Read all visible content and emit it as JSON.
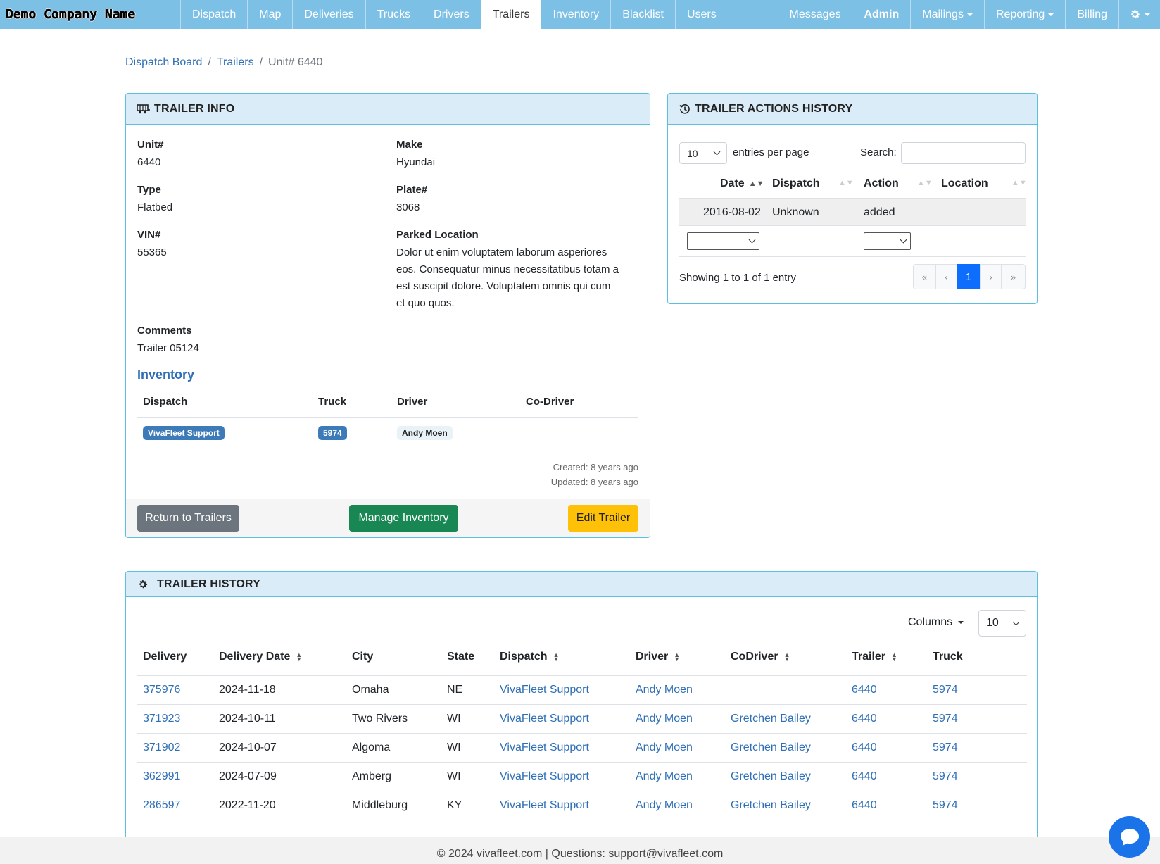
{
  "nav": {
    "brand": "Demo Company Name",
    "items": [
      "Dispatch",
      "Map",
      "Deliveries",
      "Trucks",
      "Drivers",
      "Trailers",
      "Inventory",
      "Blacklist",
      "Users"
    ],
    "right": [
      "Messages",
      "Admin",
      "Mailings",
      "Reporting",
      "Billing"
    ],
    "active": "Trailers"
  },
  "breadcrumb": {
    "home": "Dispatch Board",
    "section": "Trailers",
    "current": "Unit# 6440"
  },
  "trailer_info": {
    "title": "TRAILER INFO",
    "unit_label": "Unit#",
    "unit": "6440",
    "make_label": "Make",
    "make": "Hyundai",
    "type_label": "Type",
    "type": "Flatbed",
    "plate_label": "Plate#",
    "plate": "3068",
    "vin_label": "VIN#",
    "vin": "55365",
    "parked_label": "Parked Location",
    "parked_lines": [
      "Dolor ut enim voluptatem laborum asperiores",
      "eos. Consequatur minus necessitatibus totam a",
      "est suscipit dolore. Voluptatem omnis qui cum",
      "et quo quos."
    ],
    "comments_label": "Comments",
    "comments": "Trailer 05124",
    "inventory_title": "Inventory",
    "inventory_headers": [
      "Dispatch",
      "Truck",
      "Driver",
      "Co-Driver"
    ],
    "inventory_row": {
      "dispatch": "VivaFleet Support",
      "truck": "5974",
      "driver": "Andy Moen",
      "codriver": ""
    },
    "created": "Created: 8 years ago",
    "updated": "Updated: 8 years ago",
    "btn_return": "Return to Trailers",
    "btn_manage": "Manage Inventory",
    "btn_edit": "Edit Trailer"
  },
  "actions_history": {
    "title": "TRAILER ACTIONS HISTORY",
    "entries_value": "10",
    "entries_label": "entries per page",
    "search_label": "Search:",
    "search_value": "",
    "headers": [
      "Date",
      "Dispatch",
      "Action",
      "Location"
    ],
    "rows": [
      {
        "date": "2016-08-02",
        "dispatch": "Unknown",
        "action": "added",
        "location": ""
      }
    ],
    "info": "Showing 1 to 1 of 1 entry",
    "pages": [
      "«",
      "‹",
      "1",
      "›",
      "»"
    ]
  },
  "trailer_history": {
    "title": "TRAILER HISTORY",
    "columns_label": "Columns",
    "page_size": "10",
    "headers": [
      "Delivery",
      "Delivery Date",
      "City",
      "State",
      "Dispatch",
      "Driver",
      "CoDriver",
      "Trailer",
      "Truck"
    ],
    "rows": [
      [
        "375976",
        "2024-11-18",
        "Omaha",
        "NE",
        "VivaFleet Support",
        "Andy Moen",
        "",
        "6440",
        "5974"
      ],
      [
        "371923",
        "2024-10-11",
        "Two Rivers",
        "WI",
        "VivaFleet Support",
        "Andy Moen",
        "Gretchen Bailey",
        "6440",
        "5974"
      ],
      [
        "371902",
        "2024-10-07",
        "Algoma",
        "WI",
        "VivaFleet Support",
        "Andy Moen",
        "Gretchen Bailey",
        "6440",
        "5974"
      ],
      [
        "362991",
        "2024-07-09",
        "Amberg",
        "WI",
        "VivaFleet Support",
        "Andy Moen",
        "Gretchen Bailey",
        "6440",
        "5974"
      ],
      [
        "286597",
        "2022-11-20",
        "Middleburg",
        "KY",
        "VivaFleet Support",
        "Andy Moen",
        "Gretchen Bailey",
        "6440",
        "5974"
      ]
    ]
  },
  "footer": "© 2024 vivafleet.com | Questions: support@vivafleet.com",
  "colors": {
    "nav": "#7cc0e6",
    "link": "#2f6fb6",
    "card_border": "#5bc0de",
    "header_bg": "#d9ecf7",
    "primary": "#0d6efd",
    "success": "#198754",
    "warning": "#ffc107",
    "secondary": "#6c757d"
  },
  "icons": [
    "trailer-icon",
    "history-icon",
    "gear-icon",
    "chat-icon",
    "sort-icon"
  ]
}
